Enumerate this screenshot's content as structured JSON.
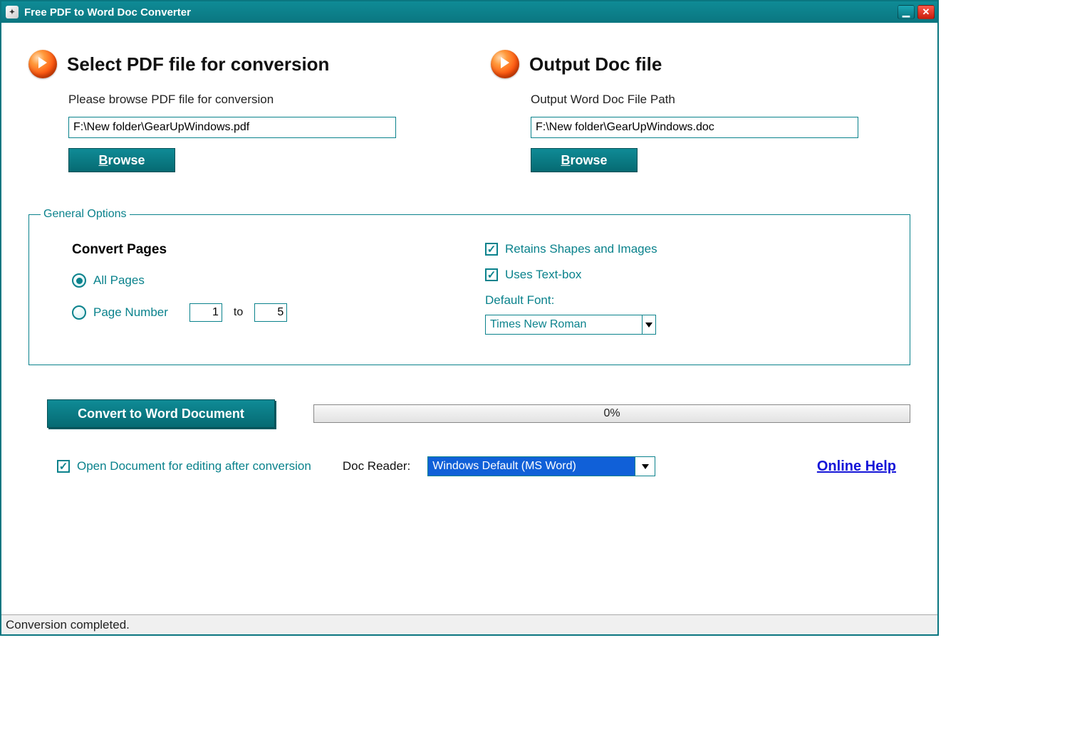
{
  "window": {
    "title": "Free PDF to Word Doc Converter"
  },
  "input_section": {
    "title": "Select PDF file for conversion",
    "subtext": "Please browse PDF file for conversion",
    "path": "F:\\New folder\\GearUpWindows.pdf",
    "browse_prefix": "B",
    "browse_rest": "rowse"
  },
  "output_section": {
    "title": "Output Doc file",
    "subtext": "Output Word Doc File Path",
    "path": "F:\\New folder\\GearUpWindows.doc",
    "browse_prefix": "B",
    "browse_rest": "rowse"
  },
  "options": {
    "legend": "General Options",
    "convert_pages_title": "Convert Pages",
    "all_pages_label": "All Pages",
    "page_number_label": "Page Number",
    "page_from": "1",
    "to_label": "to",
    "page_to": "5",
    "retain_shapes_label": "Retains Shapes and Images",
    "uses_textbox_label": "Uses Text-box",
    "default_font_label": "Default Font:",
    "default_font_value": "Times New Roman"
  },
  "actions": {
    "convert_label": "Convert to Word Document",
    "progress_text": "0%"
  },
  "bottom": {
    "open_after_label": "Open Document for editing after conversion",
    "doc_reader_label": "Doc Reader:",
    "doc_reader_value": "Windows Default (MS Word)",
    "help_label": "Online Help"
  },
  "status": {
    "text": "Conversion completed."
  }
}
